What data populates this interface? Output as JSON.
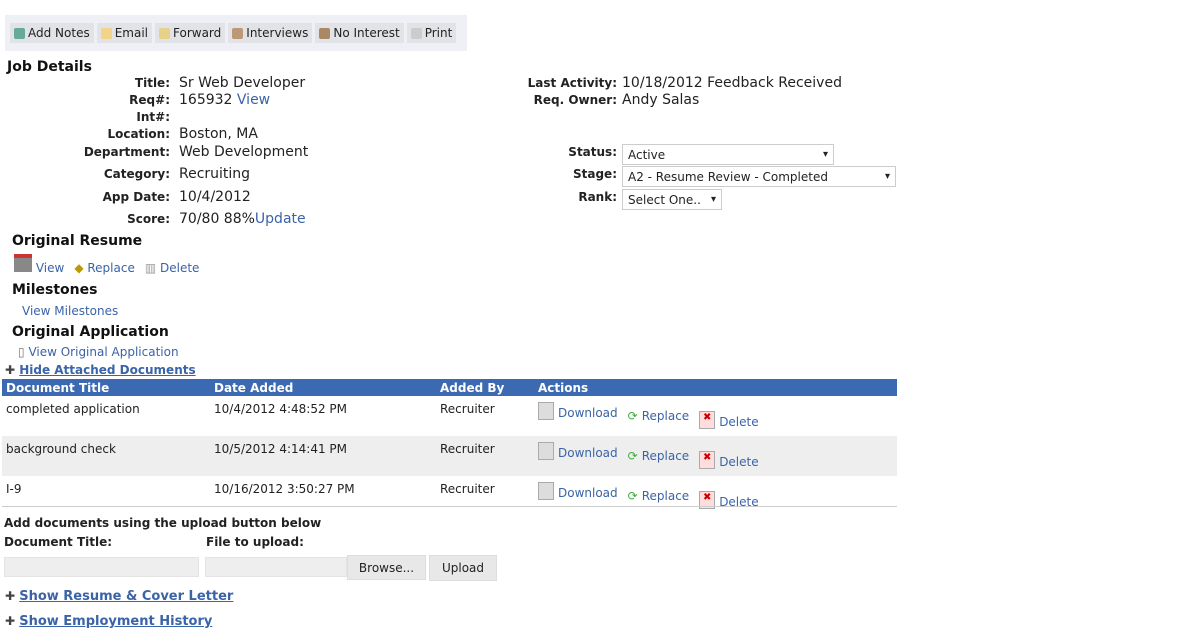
{
  "toolbar": [
    "Add Notes",
    "Email",
    "Forward",
    "Interviews",
    "No Interest",
    "Print"
  ],
  "job_details": {
    "heading": "Job Details",
    "fields": [
      {
        "label": "Title:",
        "value": "Sr Web Developer"
      },
      {
        "label": "Req#:",
        "value": "165932",
        "link": "View"
      },
      {
        "label": "Int#:",
        "value": ""
      },
      {
        "label": "Location:",
        "value": "Boston, MA"
      },
      {
        "label": "Department:",
        "value": "Web Development"
      },
      {
        "label": "Category:",
        "value": "Recruiting"
      },
      {
        "label": "App Date:",
        "value": "10/4/2012"
      },
      {
        "label": "Score:",
        "value": "70/80 88%",
        "link": "Update"
      }
    ],
    "right": [
      {
        "label": "Last Activity:",
        "value": "10/18/2012 Feedback Received"
      },
      {
        "label": "Req. Owner:",
        "value": "Andy Salas"
      }
    ],
    "status": {
      "label": "Status:",
      "value": "Active"
    },
    "stage": {
      "label": "Stage:",
      "value": "A2 - Resume Review - Completed"
    },
    "rank": {
      "label": "Rank:",
      "value": "Select One.."
    }
  },
  "resume": {
    "heading": "Original Resume",
    "view": "View",
    "replace": "Replace",
    "delete": "Delete"
  },
  "milestones": {
    "heading": "Milestones",
    "link": "View Milestones"
  },
  "application": {
    "heading": "Original Application",
    "link": "View Original Application"
  },
  "hide_docs": "Hide Attached Documents",
  "docs": {
    "headers": [
      "Document Title",
      "Date Added",
      "Added By",
      "Actions"
    ],
    "rows": [
      {
        "title": "completed application",
        "date": "10/4/2012 4:48:52 PM",
        "by": "Recruiter"
      },
      {
        "title": "background check",
        "date": "10/5/2012 4:14:41 PM",
        "by": "Recruiter"
      },
      {
        "title": "I-9",
        "date": "10/16/2012 3:50:27 PM",
        "by": "Recruiter"
      }
    ],
    "actions": {
      "download": "Download",
      "replace": "Replace",
      "delete": "Delete"
    }
  },
  "upload": {
    "intro": "Add documents using the upload button below",
    "doc_title_label": "Document Title:",
    "file_label": "File to upload:",
    "browse": "Browse...",
    "upload": "Upload"
  },
  "show_resume": "Show Resume & Cover Letter",
  "show_employment": "Show Employment History"
}
